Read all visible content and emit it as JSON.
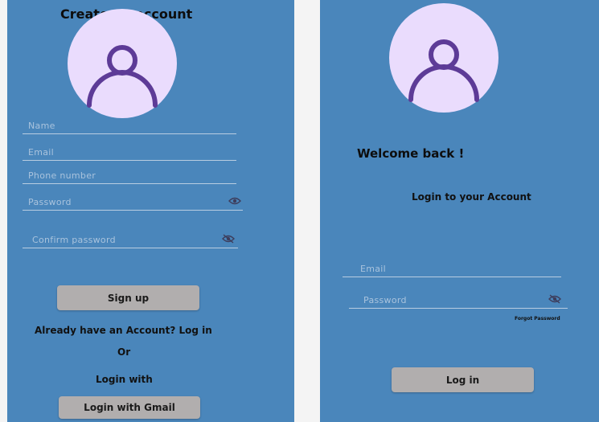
{
  "signup": {
    "title": "Create an account",
    "fields": {
      "name": {
        "placeholder": "Name",
        "value": ""
      },
      "email": {
        "placeholder": "Email",
        "value": ""
      },
      "phone": {
        "placeholder": "Phone number",
        "value": ""
      },
      "password": {
        "placeholder": "Password",
        "value": ""
      },
      "confirm_password": {
        "placeholder": "Confirm password",
        "value": ""
      }
    },
    "password_icon": "eye-icon",
    "confirm_password_icon": "eye-off-icon",
    "signup_label": "Sign up",
    "have_account": "Already have an Account? Log in",
    "or": "Or",
    "login_with": "Login with",
    "gmail_label": "Login with Gmail"
  },
  "login": {
    "welcome": "Welcome back !",
    "subtitle": "Login to your Account",
    "fields": {
      "email": {
        "placeholder": "Email",
        "value": ""
      },
      "password": {
        "placeholder": "Password",
        "value": ""
      }
    },
    "password_icon": "eye-off-icon",
    "forgot": "Forgot Password",
    "login_label": "Log in"
  },
  "colors": {
    "screen_bg": "#4a86bb",
    "avatar_bg": "#eadcfd",
    "avatar_icon": "#5d3b97",
    "button_bg": "#b1aeae"
  }
}
